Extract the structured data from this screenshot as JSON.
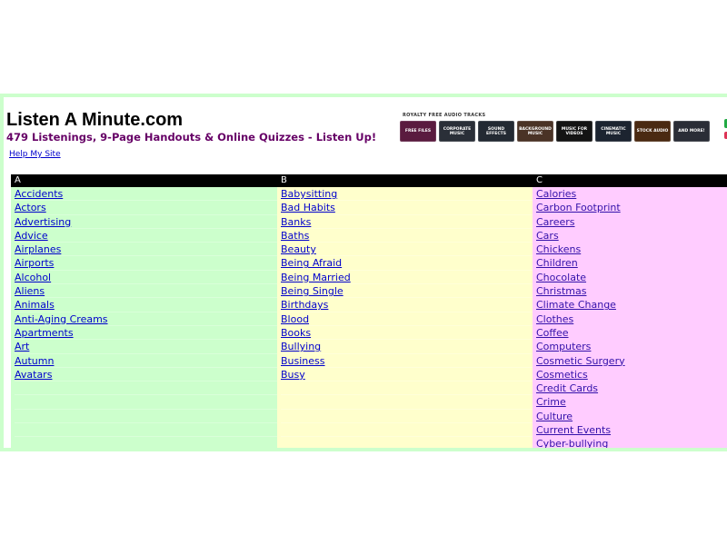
{
  "header": {
    "title": "Listen A Minute.com",
    "subtitle": "479 Listenings, 9-Page Handouts & Online Quizzes - Listen Up!",
    "help_link": "Help My Site"
  },
  "banner": {
    "caption": "ROYALTY FREE AUDIO TRACKS",
    "tiles": [
      {
        "label": "FREE FILES",
        "color": "#5a1b3f"
      },
      {
        "label": "CORPORATE MUSIC",
        "color": "#2a2f38"
      },
      {
        "label": "SOUND EFFECTS",
        "color": "#232a33"
      },
      {
        "label": "BACKGROUND MUSIC",
        "color": "#4a3326"
      },
      {
        "label": "MUSIC FOR VIDEOS",
        "color": "#141414"
      },
      {
        "label": "CINEMATIC MUSIC",
        "color": "#1c2430"
      },
      {
        "label": "STOCK AUDIO",
        "color": "#4a2a12"
      },
      {
        "label": "AND MORE!",
        "color": "#2a2d36"
      }
    ]
  },
  "columns": [
    {
      "letter": "A",
      "items": [
        "Accidents",
        "Actors",
        "Advertising",
        "Advice",
        "Airplanes",
        "Airports",
        "Alcohol",
        "Aliens",
        "Animals",
        "Anti-Aging Creams",
        "Apartments",
        "Art",
        "Autumn",
        "Avatars"
      ]
    },
    {
      "letter": "B",
      "items": [
        "Babysitting",
        "Bad Habits",
        "Banks",
        "Baths",
        "Beauty",
        "Being Afraid",
        "Being Married",
        "Being Single",
        "Birthdays",
        "Blood",
        "Books",
        "Bullying",
        "Business",
        "Busy"
      ]
    },
    {
      "letter": "C",
      "items": [
        "Calories",
        "Carbon Footprint",
        "Careers",
        "Cars",
        "Chickens",
        "Children",
        "Chocolate",
        "Christmas",
        "Climate Change",
        "Clothes",
        "Coffee",
        "Computers",
        "Cosmetic Surgery",
        "Cosmetics",
        "Credit Cards",
        "Crime",
        "Culture",
        "Current Events",
        "Cyber-bullying"
      ]
    }
  ]
}
